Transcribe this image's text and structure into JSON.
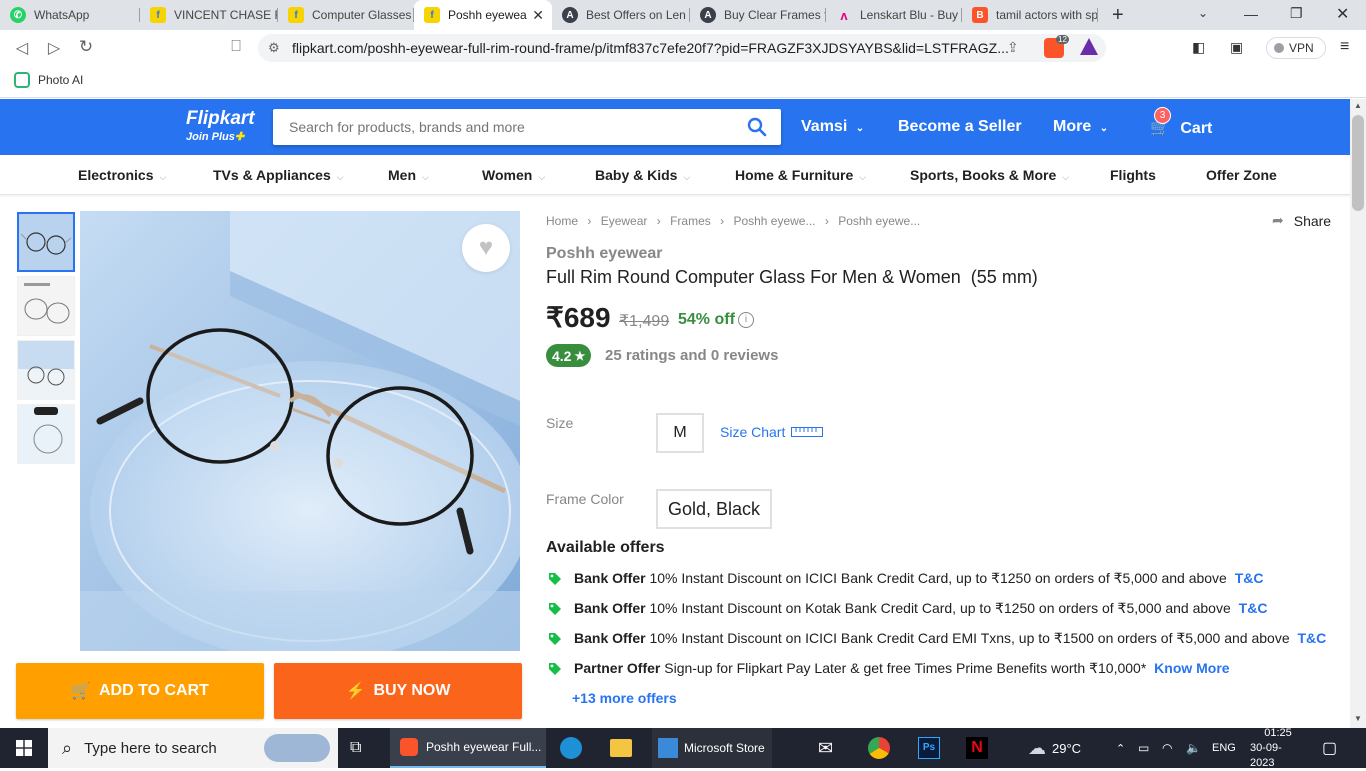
{
  "browser": {
    "tabs": [
      {
        "title": "WhatsApp",
        "icon": "whatsapp-icon"
      },
      {
        "title": "VINCENT CHASE F",
        "icon": "flipkart-icon"
      },
      {
        "title": "Computer Glasses",
        "icon": "flipkart-icon"
      },
      {
        "title": "Poshh eyewea",
        "icon": "flipkart-icon",
        "active": true
      },
      {
        "title": "Best Offers on Len",
        "icon": "lenskart-icon"
      },
      {
        "title": "Buy Clear Frames f",
        "icon": "lenskart-icon"
      },
      {
        "title": "Lenskart Blu - Buy",
        "icon": "lenskart-icon"
      },
      {
        "title": "tamil actors with sp",
        "icon": "brave-icon"
      }
    ],
    "url": "flipkart.com/poshh-eyewear-full-rim-round-frame/p/itmf837c7efe20f7?pid=FRAGZF3XJDSYAYBS&lid=LSTFRAGZ...",
    "shield_count": "12",
    "vpn_label": "VPN",
    "bookmark": "Photo AI"
  },
  "header": {
    "logo": "Flipkart",
    "logo_sub": "Join Plus",
    "search_placeholder": "Search for products, brands and more",
    "user": "Vamsi",
    "seller": "Become a Seller",
    "more": "More",
    "cart": "Cart",
    "cart_count": "3"
  },
  "categories": [
    "Electronics",
    "TVs & Appliances",
    "Men",
    "Women",
    "Baby & Kids",
    "Home & Furniture",
    "Sports, Books & More",
    "Flights",
    "Offer Zone"
  ],
  "actions": {
    "add_to_cart": "ADD TO CART",
    "buy_now": "BUY NOW"
  },
  "product": {
    "breadcrumbs": [
      "Home",
      "Eyewear",
      "Frames",
      "Poshh eyewe...",
      "Poshh eyewe..."
    ],
    "share": "Share",
    "brand": "Poshh eyewear",
    "title": "Full Rim Round Computer Glass For Men & Women  (55 mm)",
    "price": "₹689",
    "mrp": "₹1,499",
    "discount": "54% off",
    "rating": "4.2",
    "ratings_text": "25 ratings and 0 reviews",
    "size_label": "Size",
    "size_value": "M",
    "size_chart": "Size Chart",
    "color_label": "Frame Color",
    "color_value": "Gold, Black",
    "offers_title": "Available offers",
    "offers": [
      {
        "type": "Bank Offer",
        "text": "10% Instant Discount on ICICI Bank Credit Card, up to ₹1250 on orders of ₹5,000 and above",
        "link": "T&C"
      },
      {
        "type": "Bank Offer",
        "text": "10% Instant Discount on Kotak Bank Credit Card, up to ₹1250 on orders of ₹5,000 and above",
        "link": "T&C"
      },
      {
        "type": "Bank Offer",
        "text": "10% Instant Discount on ICICI Bank Credit Card EMI Txns, up to ₹1500 on orders of ₹5,000 and above",
        "link": "T&C"
      },
      {
        "type": "Partner Offer",
        "text": "Sign-up for Flipkart Pay Later & get free Times Prime Benefits worth ₹10,000*",
        "link": "Know More"
      }
    ],
    "more_offers": "+13 more offers"
  },
  "taskbar": {
    "search_placeholder": "Type here to search",
    "active_app": "Poshh eyewear Full...",
    "store_app": "Microsoft Store",
    "weather": "29°C",
    "lang": "ENG",
    "time": "01:25",
    "date": "30-09-2023"
  },
  "colors": {
    "flipkart_blue": "#2874f0",
    "add_to_cart": "#ff9f00",
    "buy_now": "#fb641b",
    "rating_green": "#388e3c"
  }
}
